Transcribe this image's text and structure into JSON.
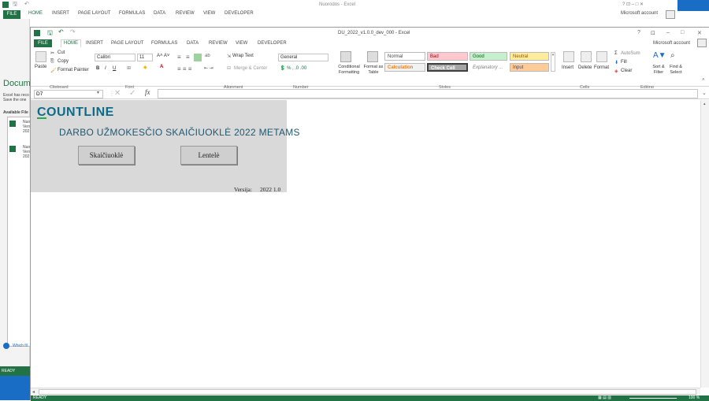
{
  "back_window": {
    "title": "Nuorodos - Excel",
    "tabs": [
      "FILE",
      "HOME",
      "INSERT",
      "PAGE LAYOUT",
      "FORMULAS",
      "DATA",
      "REVIEW",
      "VIEW",
      "DEVELOPER"
    ],
    "account": "Microsoft account",
    "side_texts": [
      "Docum",
      "Excel has reco",
      "Save the one",
      "Available File",
      "Nuo",
      "Vers",
      "202",
      "Nuo",
      "Vers",
      "202",
      "Which fil"
    ],
    "status": "READY"
  },
  "window": {
    "title": "DU_2022_v1.0.0_dev_000 - Excel",
    "tabs": [
      "FILE",
      "HOME",
      "INSERT",
      "PAGE LAYOUT",
      "FORMULAS",
      "DATA",
      "REVIEW",
      "VIEW",
      "DEVELOPER"
    ],
    "account": "Microsoft account",
    "controls": {
      "help": "?",
      "restore": "⊡",
      "minimize": "–",
      "maximize": "□",
      "close": "✕"
    }
  },
  "ribbon": {
    "clipboard": {
      "paste": "Paste",
      "cut": "Cut",
      "copy": "Copy",
      "format_painter": "Format Painter",
      "group": "Clipboard"
    },
    "font": {
      "name": "Calibri",
      "size": "11",
      "group": "Font",
      "bold": "B",
      "italic": "I",
      "underline": "U"
    },
    "alignment": {
      "wrap": "Wrap Text",
      "merge": "Merge & Center",
      "group": "Alignment"
    },
    "number": {
      "format": "General",
      "group": "Number"
    },
    "styles": {
      "conditional": "Conditional Formatting",
      "format_table": "Format as Table",
      "cells": [
        {
          "label": "Normal",
          "bg": "#ffffff",
          "fg": "#000000"
        },
        {
          "label": "Bad",
          "bg": "#ffc7ce",
          "fg": "#9c0006"
        },
        {
          "label": "Good",
          "bg": "#c6efce",
          "fg": "#006100"
        },
        {
          "label": "Neutral",
          "bg": "#ffeb9c",
          "fg": "#9c5700"
        },
        {
          "label": "Calculation",
          "bg": "#f2f2f2",
          "fg": "#fa7d00"
        },
        {
          "label": "Check Cell",
          "bg": "#a5a5a5",
          "fg": "#ffffff"
        },
        {
          "label": "Explanatory ...",
          "bg": "#ffffff",
          "fg": "#7f7f7f"
        },
        {
          "label": "Input",
          "bg": "#ffcc99",
          "fg": "#3f3f76"
        }
      ],
      "group": "Styles"
    },
    "cells": {
      "insert": "Insert",
      "delete": "Delete",
      "format": "Format",
      "group": "Cells"
    },
    "editing": {
      "autosum": "AutoSum",
      "fill": "Fill",
      "clear": "Clear",
      "sort": "Sort & Filter",
      "find": "Find & Select",
      "group": "Editing"
    }
  },
  "formula_bar": {
    "name_box": "D7",
    "fx": "fx",
    "value": ""
  },
  "sheet": {
    "logo": "COUNTLINE",
    "heading": "DARBO UŽMOKESČIO SKAIČIUOKLĖ 2022 METAMS",
    "buttons": [
      "Skaičiuoklė",
      "Lentelė"
    ],
    "version_label": "Versija:",
    "version_value": "2022 1.0"
  },
  "status": "READY",
  "zoom": "100 %",
  "colors": {
    "accent": "#217346",
    "logo": "#0b6c8a",
    "heading": "#1f5770",
    "logo_bar": "#2aa84a"
  }
}
